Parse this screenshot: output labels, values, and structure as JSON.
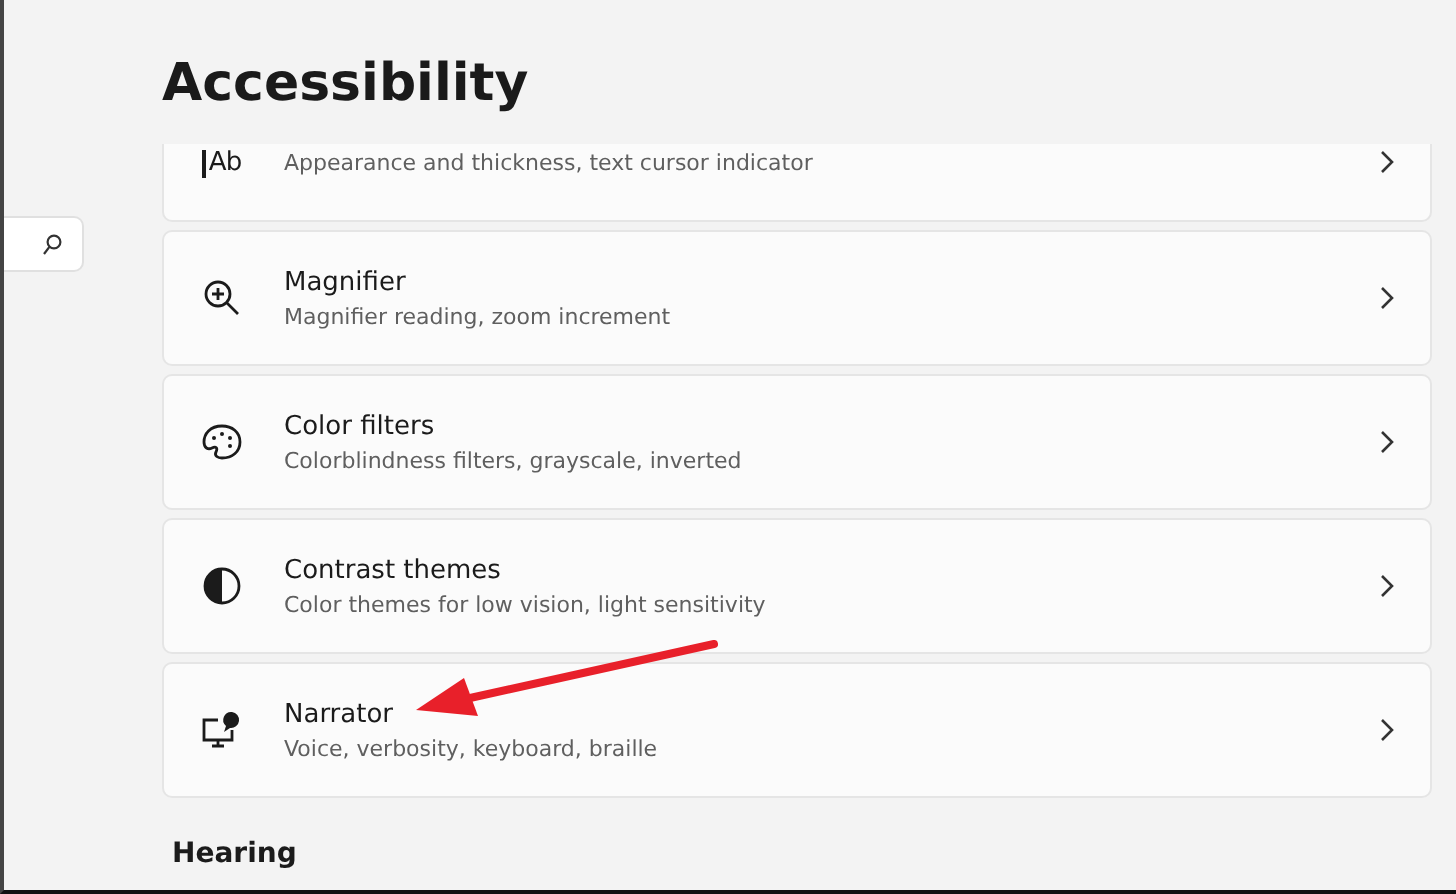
{
  "header": {
    "title": "Accessibility"
  },
  "cards": [
    {
      "kind": "cut",
      "icon_text": "Ab",
      "description": "Appearance and thickness, text cursor indicator"
    },
    {
      "kind": "full",
      "title": "Magnifier",
      "description": "Magnifier reading, zoom increment"
    },
    {
      "kind": "full",
      "title": "Color filters",
      "description": "Colorblindness filters, grayscale, inverted"
    },
    {
      "kind": "full",
      "title": "Contrast themes",
      "description": "Color themes for low vision, light sensitivity"
    },
    {
      "kind": "full",
      "title": "Narrator",
      "description": "Voice, verbosity, keyboard, braille"
    }
  ],
  "section": {
    "title": "Hearing"
  }
}
